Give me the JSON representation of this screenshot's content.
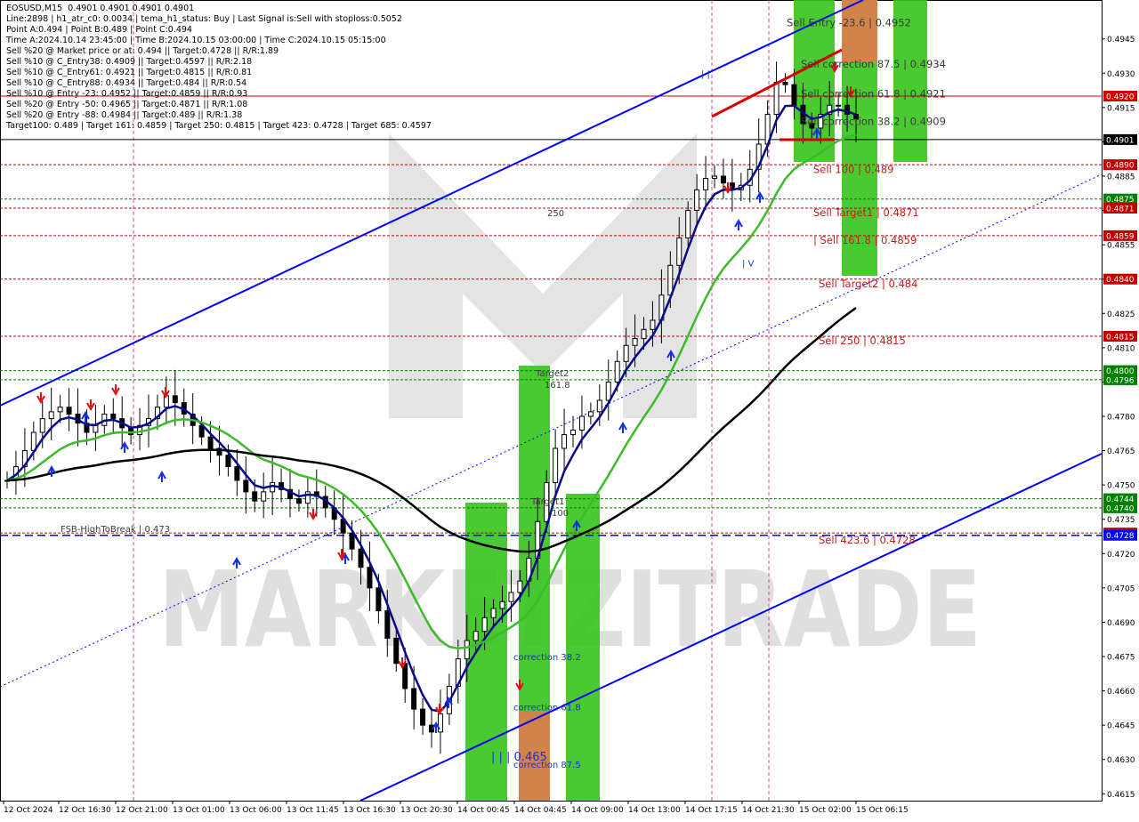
{
  "header": {
    "lines": [
      "EOSUSD,M15  0.4901 0.4901 0.4901 0.4901",
      "Line:2898 | h1_atr_c0: 0.0034 | tema_h1_status: Buy | Last Signal is:Sell with stoploss:0.5052",
      "Point A:0.494 | Point B:0.489 | Point C:0.494",
      "Time A:2024.10.14 23:45:00 | Time B:2024.10.15 03:00:00 | Time C:2024.10.15 05:15:00",
      "Sell %20 @ Market price or at: 0.494 || Target:0.4728 || R/R:1.89",
      "Sell %10 @ C_Entry38: 0.4909 || Target:0.4597 || R/R:2.18",
      "Sell %10 @ C_Entry61: 0.4921 || Target:0.4815 || R/R:0.81",
      "Sell %10 @ C_Entry88: 0.4934 || Target:0.484 || R/R:0.54",
      "Sell %10 @ Entry -23: 0.4952 || Target:0.4859 || R/R:0.93",
      "Sell %20 @ Entry -50: 0.4965 || Target:0.4871 || R/R:1.08",
      "Sell %20 @ Entry -88: 0.4984 || Target:0.489 || R/R:1.38",
      "Target100: 0.489 | Target 161: 0.4859 | Target 250: 0.4815 | Target 423: 0.4728 | Target 685: 0.4597"
    ]
  },
  "watermark": {
    "text": "MARKETZITRADE"
  },
  "chart_data": {
    "type": "candlestick",
    "symbol": "EOSUSD",
    "timeframe": "M15",
    "ylim": [
      0.4612,
      0.4962
    ],
    "x_ticks": [
      "12 Oct 2024",
      "12 Oct 16:30",
      "12 Oct 21:00",
      "13 Oct 01:00",
      "13 Oct 06:00",
      "13 Oct 11:45",
      "13 Oct 16:30",
      "13 Oct 20:30",
      "14 Oct 00:45",
      "14 Oct 04:45",
      "14 Oct 09:00",
      "14 Oct 13:00",
      "14 Oct 17:15",
      "14 Oct 21:30",
      "15 Oct 02:00",
      "15 Oct 06:15"
    ],
    "y_ticks": [
      0.4615,
      0.463,
      0.4645,
      0.466,
      0.4675,
      0.469,
      0.4705,
      0.472,
      0.4735,
      0.475,
      0.4765,
      0.478,
      0.4795,
      0.481,
      0.4825,
      0.484,
      0.4855,
      0.487,
      0.4885,
      0.49,
      0.4915,
      0.493,
      0.4945
    ],
    "closes": [
      0.4752,
      0.4758,
      0.4765,
      0.4773,
      0.4779,
      0.4782,
      0.4784,
      0.4781,
      0.4777,
      0.4773,
      0.4776,
      0.4781,
      0.4779,
      0.4775,
      0.4772,
      0.4776,
      0.4779,
      0.4784,
      0.4789,
      0.4786,
      0.4781,
      0.4776,
      0.4771,
      0.4766,
      0.4763,
      0.4758,
      0.4752,
      0.4747,
      0.4743,
      0.4747,
      0.4751,
      0.4748,
      0.4744,
      0.4742,
      0.4747,
      0.4745,
      0.474,
      0.4735,
      0.4729,
      0.4722,
      0.4714,
      0.4705,
      0.4695,
      0.4683,
      0.4672,
      0.4661,
      0.4652,
      0.4645,
      0.4642,
      0.465,
      0.4662,
      0.4674,
      0.4682,
      0.4686,
      0.4692,
      0.4696,
      0.4699,
      0.4703,
      0.4708,
      0.4718,
      0.4734,
      0.4751,
      0.4766,
      0.4772,
      0.4774,
      0.478,
      0.4782,
      0.4787,
      0.4795,
      0.4804,
      0.4811,
      0.4814,
      0.4818,
      0.4822,
      0.4833,
      0.4846,
      0.4858,
      0.487,
      0.4879,
      0.4884,
      0.4885,
      0.4882,
      0.4879,
      0.4881,
      0.4888,
      0.4899,
      0.4912,
      0.4926,
      0.4925,
      0.4916,
      0.4908,
      0.4906,
      0.4912,
      0.4916,
      0.4916,
      0.4912,
      0.491
    ],
    "candles_approx": 97,
    "hlines": [
      {
        "value": 0.492,
        "label": "0.4920",
        "color": "#d40000",
        "style": "solid"
      },
      {
        "value": 0.4901,
        "label": "0.4901",
        "color": "#000000",
        "style": "current"
      },
      {
        "value": 0.489,
        "label": "0.4890",
        "color": "#c00000",
        "style": "dotted"
      },
      {
        "value": 0.4875,
        "label": "0.4875",
        "color": "#008000",
        "style": "dotted"
      },
      {
        "value": 0.4871,
        "label": "0.4871",
        "color": "#c00000",
        "style": "dotted"
      },
      {
        "value": 0.4859,
        "label": "0.4859",
        "color": "#c00000",
        "style": "dotted"
      },
      {
        "value": 0.484,
        "label": "0.4840",
        "color": "#c00000",
        "style": "dotted"
      },
      {
        "value": 0.4815,
        "label": "0.4815",
        "color": "#c00000",
        "style": "dotted"
      },
      {
        "value": 0.48,
        "label": "0.4800",
        "color": "#008000",
        "style": "dotted"
      },
      {
        "value": 0.4796,
        "label": "0.4796",
        "color": "#008000",
        "style": "dotted"
      },
      {
        "value": 0.4744,
        "label": "0.4744",
        "color": "#008000",
        "style": "dotted"
      },
      {
        "value": 0.474,
        "label": "0.4740",
        "color": "#008000",
        "style": "dotted"
      },
      {
        "value": 0.4729,
        "label": "0.4729",
        "color": "#c00000",
        "style": "dotted"
      },
      {
        "value": 0.4728,
        "label": "0.4728",
        "color": "#0000ff",
        "style": "dashed"
      }
    ],
    "level_labels": [
      {
        "text": "Sell Entry -23.6 | 0.4952",
        "value": 0.4952
      },
      {
        "text": "Sell correction 87.5 | 0.4934",
        "value": 0.4934
      },
      {
        "text": "Sell correction 61.8 | 0.4921",
        "value": 0.4921
      },
      {
        "text": "Sell correction 38.2 | 0.4909",
        "value": 0.4909
      },
      {
        "text": "Sell 100 | 0.489",
        "value": 0.4888
      },
      {
        "text": "Sell Target1 | 0.4871",
        "value": 0.4869
      },
      {
        "text": "| Sell 161.8 | 0.4859",
        "value": 0.4857
      },
      {
        "text": "Sell Target2 | 0.484",
        "value": 0.4838
      },
      {
        "text": "Sell  250 | 0.4815",
        "value": 0.4813
      },
      {
        "text": "Sell  423.6 | 0.4728",
        "value": 0.4726
      }
    ],
    "misc_labels": [
      {
        "text": "250",
        "value": 0.4869
      },
      {
        "text": "Target2",
        "value": 0.4799
      },
      {
        "text": "161.8",
        "value": 0.4794
      },
      {
        "text": "Target1",
        "value": 0.4743
      },
      {
        "text": "100",
        "value": 0.4738
      },
      {
        "text": "FSB-HighToBreak | 0.473",
        "value": 0.4731
      },
      {
        "text": "correction 38.2",
        "value": 0.4675
      },
      {
        "text": "correction 61.8",
        "value": 0.4653
      },
      {
        "text": "| | | 0.465",
        "value": 0.4631
      },
      {
        "text": "correction 87.5",
        "value": 0.4628
      },
      {
        "text": "| V",
        "value": 0.4847
      },
      {
        "text": "| |",
        "value": 0.493
      }
    ],
    "colors": {
      "bull_zone": "#35c41a",
      "bear_zone": "#e07c4c",
      "ma_black": "#000000",
      "ma_green": "#3dbb2a",
      "ma_navy": "#0a0a8c",
      "channel": "#0000ff",
      "price_red": "#d40000"
    }
  }
}
